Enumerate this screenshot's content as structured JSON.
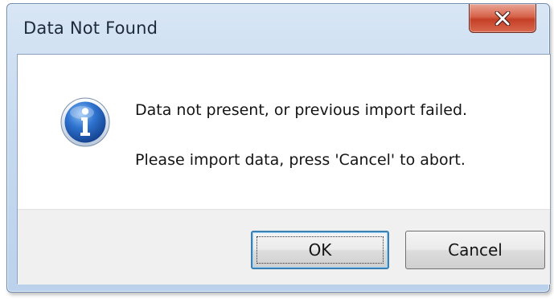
{
  "window": {
    "title": "Data Not Found"
  },
  "icons": {
    "message_icon": "information-icon",
    "close_icon": "close-icon"
  },
  "message": {
    "line1": "Data not present, or previous import failed.",
    "line2": "Please import data, press 'Cancel' to abort."
  },
  "buttons": {
    "ok_label": "OK",
    "cancel_label": "Cancel",
    "default": "OK"
  },
  "colors": {
    "close_button": "#c94a32",
    "titlebar": "#c6d9ef",
    "info_icon": "#1f5fb8",
    "default_button_border": "#3c7fb1"
  }
}
